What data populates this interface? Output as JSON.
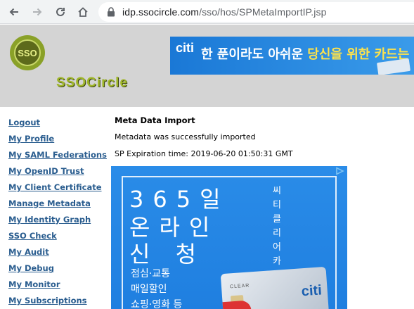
{
  "browser": {
    "url_domain": "idp.ssocircle.com",
    "url_path": "/sso/hos/SPMetaImportIP.jsp"
  },
  "header": {
    "logo_mark": "SSO",
    "logo_text": "SSOCircle",
    "banner": {
      "brand": "citi",
      "text_before": "한 푼이라도 아쉬운 ",
      "text_highlight": "당신을 위한 카드는"
    }
  },
  "sidebar": {
    "items": [
      {
        "label": "Logout"
      },
      {
        "label": "My Profile"
      },
      {
        "label": "My SAML Federations"
      },
      {
        "label": "My OpenID Trust"
      },
      {
        "label": "My Client Certificate"
      },
      {
        "label": "Manage Metadata"
      },
      {
        "label": "My Identity Graph"
      },
      {
        "label": "SSO Check"
      },
      {
        "label": "My Audit"
      },
      {
        "label": "My Debug"
      },
      {
        "label": "My Monitor"
      },
      {
        "label": "My Subscriptions"
      }
    ]
  },
  "main": {
    "title": "Meta Data Import",
    "status": "Metadata was successfully imported",
    "expiration": "SP Expiration time: 2019-06-20 01:50:31 GMT"
  },
  "ad": {
    "line1": "365일",
    "line2": "온라인",
    "line3": "신 청",
    "small1": "점심·교통",
    "small2": "매일할인",
    "small3": "쇼핑·영화 등",
    "vertical": "씨티클리어카드",
    "card_brand": "citi",
    "card_label": "CLEAR"
  }
}
